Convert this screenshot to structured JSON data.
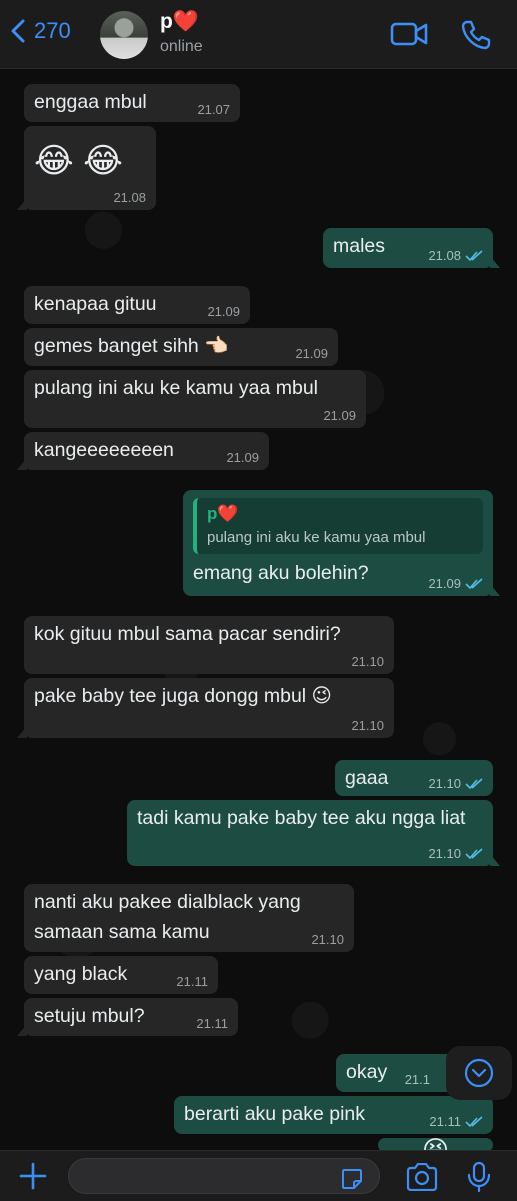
{
  "header": {
    "back_count": "270",
    "contact_name": "p",
    "contact_heart": "❤️",
    "status": "online"
  },
  "messages": [
    {
      "dir": "in",
      "text": "enggaa mbul",
      "time": "21.07"
    },
    {
      "dir": "in",
      "text": "😂 😂",
      "time": "21.08"
    },
    {
      "dir": "out",
      "text": "males",
      "time": "21.08"
    },
    {
      "dir": "in",
      "text": "kenapaa gituu",
      "time": "21.09"
    },
    {
      "dir": "in",
      "text": "gemes banget sihh 👈🏻",
      "time": "21.09"
    },
    {
      "dir": "in",
      "text": "pulang ini aku ke kamu yaa mbul",
      "time": "21.09"
    },
    {
      "dir": "in",
      "text": "kangeeeeeeeen",
      "time": "21.09"
    },
    {
      "dir": "out",
      "quote_name": "p",
      "quote_text": "pulang ini aku ke kamu yaa mbul",
      "text": "emang aku bolehin?",
      "time": "21.09"
    },
    {
      "dir": "in",
      "text": "kok gituu mbul sama pacar sendiri?",
      "time": "21.10"
    },
    {
      "dir": "in",
      "text": "pake baby tee juga dongg mbul 😉",
      "time": "21.10"
    },
    {
      "dir": "out",
      "text": "gaaa",
      "time": "21.10"
    },
    {
      "dir": "out",
      "text": "tadi kamu pake baby tee aku ngga liat",
      "time": "21.10"
    },
    {
      "dir": "in",
      "text": "nanti aku pakee dialblack yang samaan sama kamu",
      "time": "21.10"
    },
    {
      "dir": "in",
      "text": "yang black",
      "time": "21.11"
    },
    {
      "dir": "in",
      "text": "setuju mbul?",
      "time": "21.11"
    },
    {
      "dir": "out",
      "text": "okay",
      "time": "21.1"
    },
    {
      "dir": "out",
      "text": "berarti aku pake pink",
      "time": "21.11"
    },
    {
      "dir": "out",
      "text": "😆",
      "time": ""
    }
  ],
  "icons": {
    "back": "chevron-left-icon",
    "video": "video-camera-icon",
    "call": "phone-icon",
    "scroll": "chevron-down-circle-icon",
    "attach": "plus-icon",
    "sticker": "sticker-icon",
    "camera": "camera-icon",
    "mic": "microphone-icon",
    "read": "double-check-icon"
  },
  "colors": {
    "accent": "#3b8ff5",
    "incoming": "#262626",
    "outgoing": "#1d4d42",
    "quote_accent": "#25b080"
  }
}
